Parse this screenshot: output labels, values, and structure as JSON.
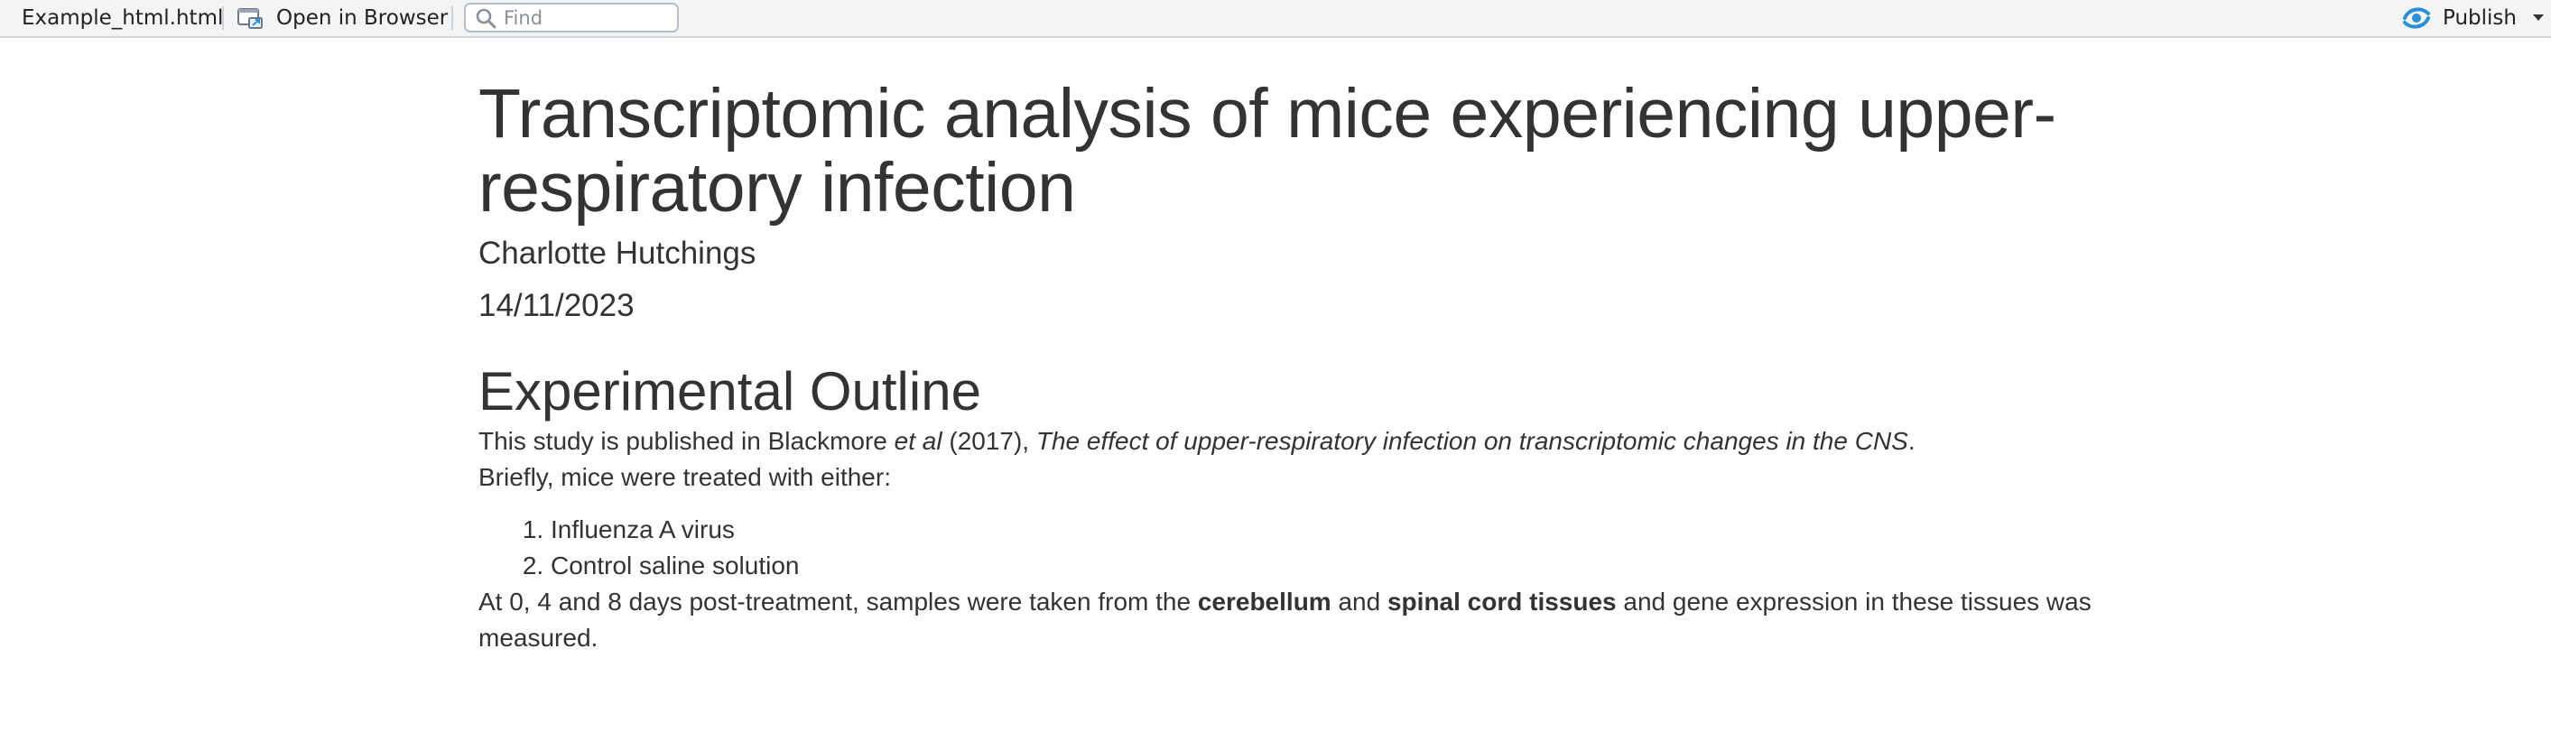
{
  "toolbar": {
    "filename": "Example_html.html",
    "open_in_browser": "Open in Browser",
    "find_placeholder": "Find",
    "publish": "Publish",
    "colors": {
      "background": "#f3f4f6",
      "publish_icon": "#2a8fd6"
    },
    "icons": [
      "browser-window-icon",
      "search-icon",
      "publish-icon",
      "caret-down-icon"
    ]
  },
  "document": {
    "title": "Transcriptomic analysis of mice experiencing upper-respiratory infection",
    "author": "Charlotte Hutchings",
    "date": "14/11/2023",
    "section_heading": "Experimental Outline",
    "para1": {
      "part1": "This study is published in Blackmore ",
      "em1": "et al",
      "part2": " (2017), ",
      "em2": "The effect of upper-respiratory infection on transcriptomic changes in the CNS",
      "part3": "."
    },
    "para2": "Briefly, mice were treated with either:",
    "treatments": [
      "Influenza A virus",
      "Control saline solution"
    ],
    "para3": {
      "part1": "At 0, 4 and 8 days post-treatment, samples were taken from the ",
      "bold1": "cerebellum",
      "part2": " and ",
      "bold2": "spinal cord tissues",
      "part3": " and gene expression in these tissues was measured."
    }
  }
}
